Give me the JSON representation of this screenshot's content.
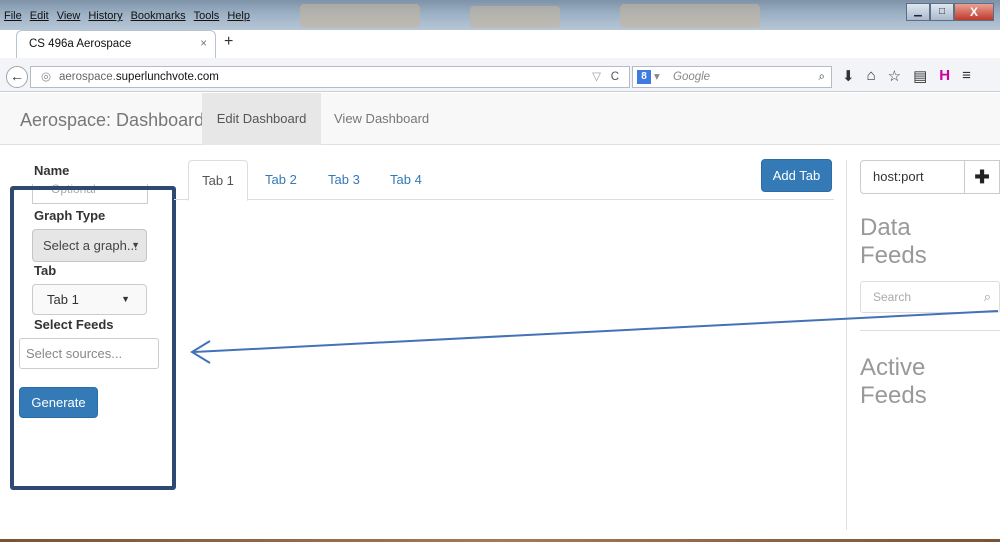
{
  "browser": {
    "menu": [
      "File",
      "Edit",
      "View",
      "History",
      "Bookmarks",
      "Tools",
      "Help"
    ],
    "tab_title": "CS 496a Aerospace",
    "tab_close": "×",
    "new_tab": "+",
    "url_plain": "aerospace.",
    "url_domain": "superlunchvote.com",
    "search_engine": "Google",
    "window_buttons": {
      "minimize": "▁",
      "maximize": "□",
      "close": "X"
    }
  },
  "app": {
    "brand": "Aerospace: Dashboard",
    "nav": {
      "edit": "Edit Dashboard",
      "view": "View Dashboard"
    }
  },
  "form": {
    "name_label": "Name",
    "name_placeholder": "Optional",
    "graph_type_label": "Graph Type",
    "graph_select": "Select a graph...",
    "tab_label": "Tab",
    "tab_select": "Tab 1",
    "feeds_label": "Select Feeds",
    "sources_placeholder": "Select sources...",
    "generate": "Generate"
  },
  "tabs": [
    "Tab 1",
    "Tab 2",
    "Tab 3",
    "Tab 4"
  ],
  "add_tab": "Add Tab",
  "right": {
    "host": "host:port",
    "data_feeds_1": "Data",
    "data_feeds_2": "Feeds",
    "search_placeholder": "Search",
    "active_feeds_1": "Active",
    "active_feeds_2": "Feeds"
  },
  "colors": {
    "primary": "#337ab7",
    "annotation": "#2e4a72",
    "arrow": "#4472b8"
  }
}
